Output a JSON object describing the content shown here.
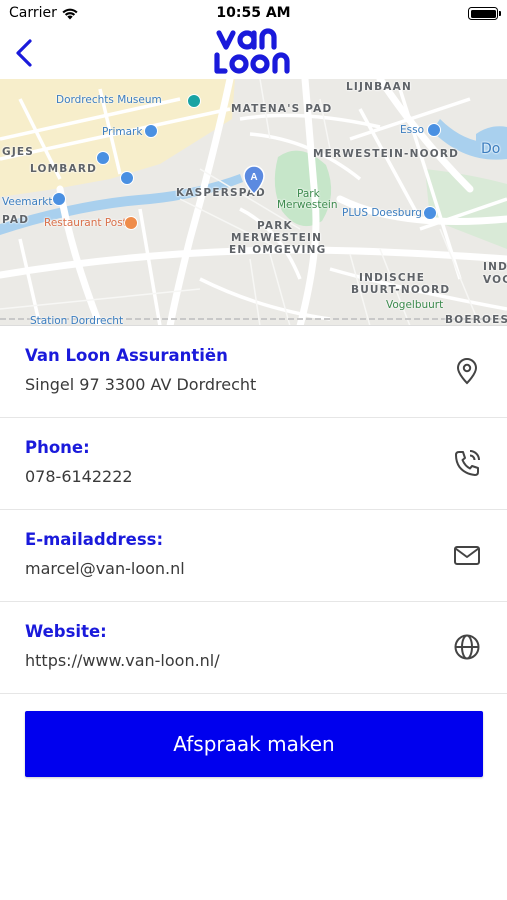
{
  "status_bar": {
    "carrier": "Carrier",
    "time": "10:55 AM"
  },
  "nav": {
    "back_icon": "chevron-left-icon",
    "logo_line1": "van",
    "logo_line2": "loon"
  },
  "map": {
    "streets": [
      "LIJNBAAN",
      "MATENA'S PAD",
      "MERWESTEIN-NOORD",
      "GJES",
      "LOMBARD",
      "KASPERSPAD",
      "PARK",
      "MERWESTEIN",
      "EN OMGEVING",
      "INDISCHE",
      "BUURT-NOORD",
      "PAD",
      "IND",
      "VOG",
      "BOEROES"
    ],
    "pois": {
      "museum": "Dordrechts Museum",
      "primark": "Primark",
      "esso": "Esso",
      "park1": "Park",
      "park2": "Merwestein",
      "plus": "PLUS Doesburg",
      "veemarkt": "Veemarkt",
      "restaurant": "Restaurant Post",
      "station": "Station Dordrecht",
      "vogelbuurt": "Vogelbuurt",
      "do": "Do"
    }
  },
  "contact": {
    "company": {
      "title": "Van Loon Assurantiën",
      "value": "Singel 97 3300 AV Dordrecht",
      "icon": "location-pin-icon"
    },
    "phone": {
      "title": "Phone:",
      "value": "078-6142222",
      "icon": "phone-icon"
    },
    "email": {
      "title": "E-mailaddress:",
      "value": "marcel@van-loon.nl",
      "icon": "mail-icon"
    },
    "website": {
      "title": "Website:",
      "value": "https://www.van-loon.nl/",
      "icon": "globe-icon"
    }
  },
  "cta": {
    "label": "Afspraak maken"
  },
  "colors": {
    "brand_blue": "#1a1adb",
    "button_blue": "#0000ee",
    "text_gray": "#3a3a3a"
  }
}
